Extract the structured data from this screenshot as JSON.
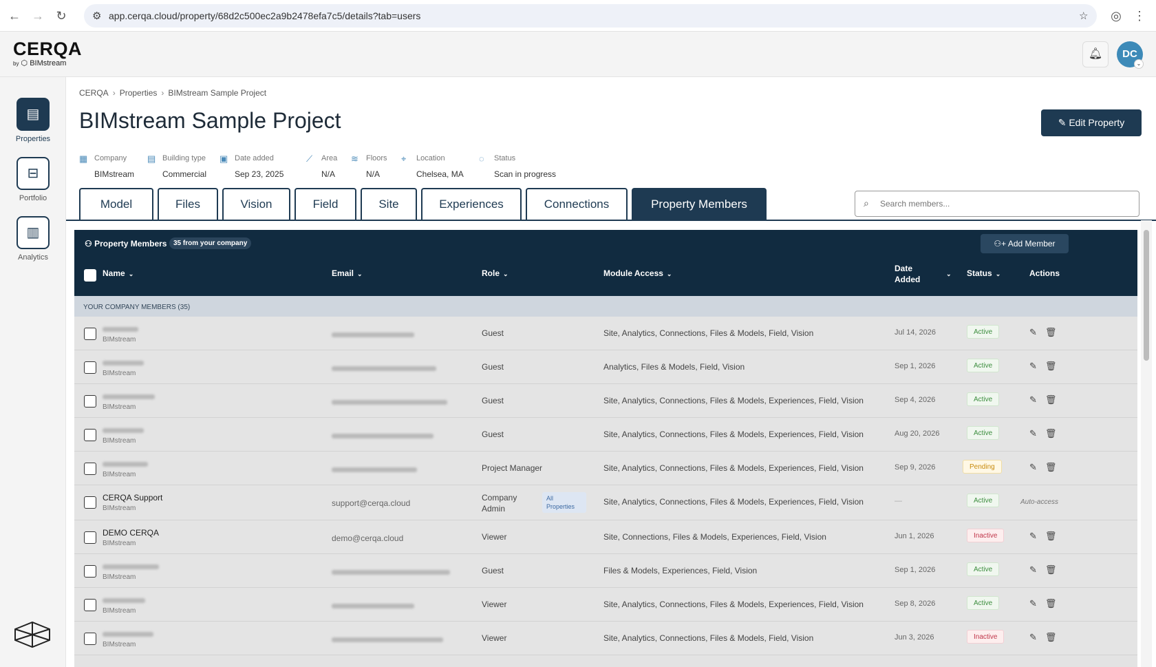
{
  "browser": {
    "url": "app.cerqa.cloud/property/68d2c500ec2a9b2478efa7c5/details?tab=users"
  },
  "header": {
    "logo": "CERQA",
    "logo_by": "by",
    "logo_sub": "BIMstream",
    "avatar": "DC"
  },
  "sidebar": {
    "items": [
      {
        "label": "Properties",
        "active": true
      },
      {
        "label": "Portfolio"
      },
      {
        "label": "Analytics"
      }
    ]
  },
  "breadcrumb": [
    "CERQA",
    "Properties",
    "BIMstream Sample Project"
  ],
  "page": {
    "title": "BIMstream Sample Project",
    "edit_label": "Edit Property"
  },
  "meta": [
    {
      "label": "Company",
      "value": "BIMstream",
      "icon": "building-icon"
    },
    {
      "label": "Building type",
      "value": "Commercial",
      "icon": "document-icon"
    },
    {
      "label": "Date added",
      "value": "Sep 23, 2025",
      "icon": "calendar-icon"
    },
    {
      "label": "Area",
      "value": "N/A",
      "icon": "ruler-icon"
    },
    {
      "label": "Floors",
      "value": "N/A",
      "icon": "layers-icon"
    },
    {
      "label": "Location",
      "value": "Chelsea, MA",
      "icon": "pin-icon"
    },
    {
      "label": "Status",
      "value": "Scan in progress",
      "icon": "check-circle-icon"
    }
  ],
  "tabs": [
    "Model",
    "Files",
    "Vision",
    "Field",
    "Site",
    "Experiences",
    "Connections",
    "Property Members"
  ],
  "active_tab": "Property Members",
  "search": {
    "placeholder": "Search members..."
  },
  "panel": {
    "title": "Property Members",
    "badge": "35 from your company",
    "add_label": "Add Member",
    "columns": {
      "name": "Name",
      "email": "Email",
      "role": "Role",
      "module": "Module Access",
      "date": "Date Added",
      "status": "Status",
      "actions": "Actions"
    },
    "group": "YOUR COMPANY MEMBERS (35)",
    "rows": [
      {
        "name": "",
        "company": "BIMstream",
        "email": "",
        "role": "Guest",
        "modules": "Site, Analytics, Connections, Files & Models, Field, Vision",
        "date": "Jul 14, 2026",
        "status": "Active"
      },
      {
        "name": "",
        "company": "BIMstream",
        "email": "",
        "role": "Guest",
        "modules": "Analytics, Files & Models, Field, Vision",
        "date": "Sep 1, 2026",
        "status": "Active"
      },
      {
        "name": "",
        "company": "BIMstream",
        "email": "",
        "role": "Guest",
        "modules": "Site, Analytics, Connections, Files & Models, Experiences, Field, Vision",
        "date": "Sep 4, 2026",
        "status": "Active"
      },
      {
        "name": "",
        "company": "BIMstream",
        "email": "",
        "role": "Guest",
        "modules": "Site, Analytics, Connections, Files & Models, Experiences, Field, Vision",
        "date": "Aug 20, 2026",
        "status": "Active"
      },
      {
        "name": "",
        "company": "BIMstream",
        "email": "",
        "role": "Project Manager",
        "modules": "Site, Analytics, Connections, Files & Models, Experiences, Field, Vision",
        "date": "Sep 9, 2026",
        "status": "Pending"
      },
      {
        "name": "CERQA Support",
        "company": "BIMstream",
        "email": "support@cerqa.cloud",
        "role": "Company Admin",
        "role_tag": "All Properties",
        "modules": "Site, Analytics, Connections, Files & Models, Experiences, Field, Vision",
        "date": "—",
        "status": "Active",
        "auto": "Auto-access"
      },
      {
        "name": "DEMO CERQA",
        "company": "BIMstream",
        "email": "demo@cerqa.cloud",
        "role": "Viewer",
        "modules": "Site, Connections, Files & Models, Experiences, Field, Vision",
        "date": "Jun 1, 2026",
        "status": "Inactive"
      },
      {
        "name": "",
        "company": "BIMstream",
        "email": "",
        "role": "Guest",
        "modules": "Files & Models, Experiences, Field, Vision",
        "date": "Sep 1, 2026",
        "status": "Active"
      },
      {
        "name": "",
        "company": "BIMstream",
        "email": "",
        "role": "Viewer",
        "modules": "Site, Analytics, Connections, Files & Models, Experiences, Field, Vision",
        "date": "Sep 8, 2026",
        "status": "Active"
      },
      {
        "name": "",
        "company": "BIMstream",
        "email": "",
        "role": "Viewer",
        "modules": "Site, Analytics, Connections, Files & Models, Field, Vision",
        "date": "Jun 3, 2026",
        "status": "Inactive"
      }
    ]
  },
  "colors": {
    "primary": "#1e3a52",
    "panel_head": "#112b40",
    "accent": "#4a8ab8"
  }
}
